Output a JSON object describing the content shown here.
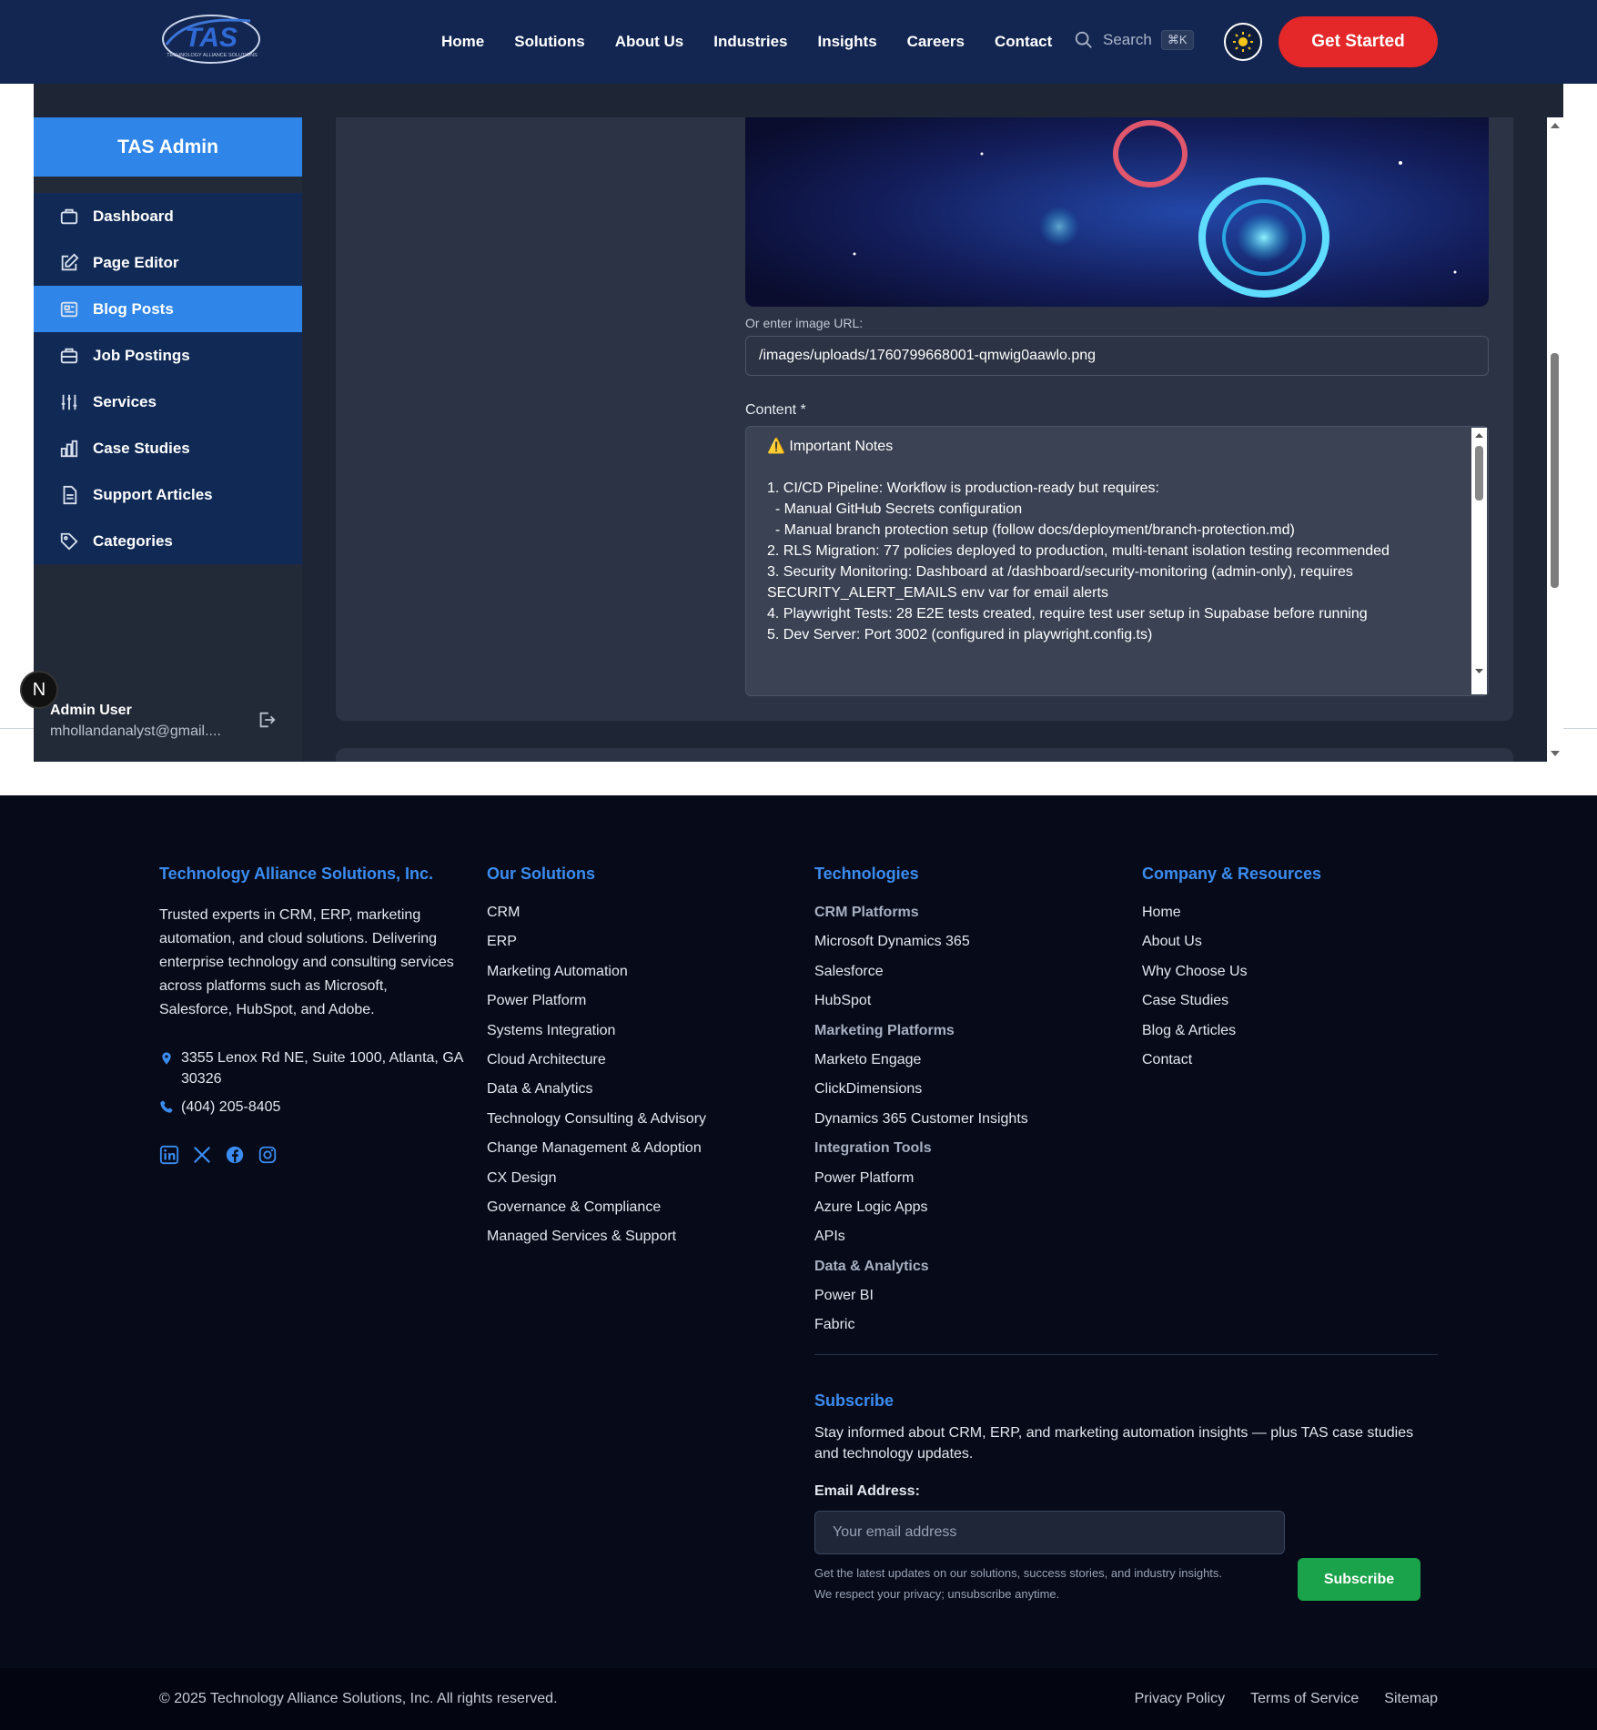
{
  "header": {
    "logo_text": "TAS",
    "logo_subtext": "TECHNOLOGY ALLIANCE SOLUTIONS",
    "nav": [
      "Home",
      "Solutions",
      "About Us",
      "Industries",
      "Insights",
      "Careers",
      "Contact"
    ],
    "search_label": "Search",
    "search_shortcut": "⌘K",
    "cta_label": "Get Started"
  },
  "sidebar": {
    "title": "TAS Admin",
    "items": [
      {
        "label": "Dashboard",
        "icon": "briefcase-icon"
      },
      {
        "label": "Page Editor",
        "icon": "edit-icon"
      },
      {
        "label": "Blog Posts",
        "icon": "newspaper-icon",
        "active": true
      },
      {
        "label": "Job Postings",
        "icon": "briefcase-icon"
      },
      {
        "label": "Services",
        "icon": "sliders-icon"
      },
      {
        "label": "Case Studies",
        "icon": "bar-chart-icon"
      },
      {
        "label": "Support Articles",
        "icon": "file-icon"
      },
      {
        "label": "Categories",
        "icon": "tag-icon"
      }
    ],
    "user_name": "Admin User",
    "user_email": "mhollandanalyst@gmail....",
    "badge": "N"
  },
  "editor": {
    "image_url_label": "Or enter image URL:",
    "image_url_value": "/images/uploads/1760799668001-qmwig0aawlo.png",
    "content_label": "Content *",
    "content_lines": [
      "⚠️ Important Notes",
      "",
      "1. CI/CD Pipeline: Workflow is production-ready but requires:",
      "  - Manual GitHub Secrets configuration",
      "  - Manual branch protection setup (follow docs/deployment/branch-protection.md)",
      "2. RLS Migration: 77 policies deployed to production, multi-tenant isolation testing recommended",
      "3. Security Monitoring: Dashboard at /dashboard/security-monitoring (admin-only), requires SECURITY_ALERT_EMAILS env var for email alerts",
      "4. Playwright Tests: 28 E2E tests created, require test user setup in Supabase before running",
      "5. Dev Server: Port 3002 (configured in playwright.config.ts)"
    ]
  },
  "footer": {
    "company": {
      "heading": "Technology Alliance Solutions, Inc.",
      "description": "Trusted experts in CRM, ERP, marketing automation, and cloud solutions. Delivering enterprise technology and consulting services across platforms such as Microsoft, Salesforce, HubSpot, and Adobe.",
      "address": "3355 Lenox Rd NE, Suite 1000, Atlanta, GA 30326",
      "phone": "(404) 205-8405"
    },
    "solutions": {
      "heading": "Our Solutions",
      "items": [
        "CRM",
        "ERP",
        "Marketing Automation",
        "Power Platform",
        "Systems Integration",
        "Cloud Architecture",
        "Data & Analytics",
        "Technology Consulting & Advisory",
        "Change Management & Adoption",
        "CX Design",
        "Governance & Compliance",
        "Managed Services & Support"
      ]
    },
    "technologies": {
      "heading": "Technologies",
      "items": [
        {
          "label": "CRM Platforms",
          "category": true
        },
        {
          "label": "Microsoft Dynamics 365"
        },
        {
          "label": "Salesforce"
        },
        {
          "label": "HubSpot"
        },
        {
          "label": "Marketing Platforms",
          "category": true
        },
        {
          "label": "Marketo Engage"
        },
        {
          "label": "ClickDimensions"
        },
        {
          "label": "Dynamics 365 Customer Insights"
        },
        {
          "label": "Integration Tools",
          "category": true
        },
        {
          "label": "Power Platform"
        },
        {
          "label": "Azure Logic Apps"
        },
        {
          "label": "APIs"
        },
        {
          "label": "Data & Analytics",
          "category": true
        },
        {
          "label": "Power BI"
        },
        {
          "label": "Fabric"
        }
      ]
    },
    "resources": {
      "heading": "Company & Resources",
      "items": [
        "Home",
        "About Us",
        "Why Choose Us",
        "Case Studies",
        "Blog & Articles",
        "Contact"
      ]
    },
    "subscribe": {
      "heading": "Subscribe",
      "description": "Stay informed about CRM, ERP, and marketing automation insights — plus TAS case studies and technology updates.",
      "email_label": "Email Address:",
      "email_placeholder": "Your email address",
      "note_1": "Get the latest updates on our solutions, success stories, and industry insights.",
      "note_2": "We respect your privacy; unsubscribe anytime.",
      "button": "Subscribe"
    },
    "copyright": "© 2025 Technology Alliance Solutions, Inc. All rights reserved.",
    "bottom_links": [
      "Privacy Policy",
      "Terms of Service",
      "Sitemap"
    ]
  }
}
